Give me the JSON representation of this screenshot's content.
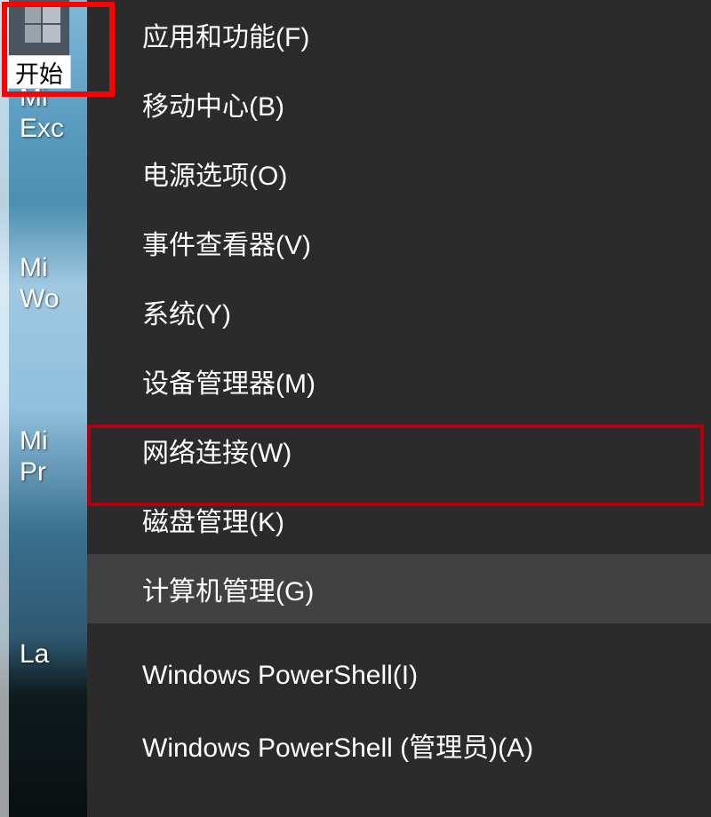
{
  "start": {
    "tooltip": "开始"
  },
  "desktop_icons": {
    "excel_lines": "Mi\nExc",
    "word_lines": "Mi\nWo",
    "ppt_lines": "Mi\nPr",
    "last_line": "La"
  },
  "menu": {
    "items": [
      {
        "label": "应用和功能(F)",
        "name": "apps-and-features"
      },
      {
        "label": "移动中心(B)",
        "name": "mobility-center"
      },
      {
        "label": "电源选项(O)",
        "name": "power-options"
      },
      {
        "label": "事件查看器(V)",
        "name": "event-viewer"
      },
      {
        "label": "系统(Y)",
        "name": "system"
      },
      {
        "label": "设备管理器(M)",
        "name": "device-manager"
      },
      {
        "label": "网络连接(W)",
        "name": "network-connections"
      },
      {
        "label": "磁盘管理(K)",
        "name": "disk-management"
      },
      {
        "label": "计算机管理(G)",
        "name": "computer-management"
      },
      {
        "label": "Windows PowerShell(I)",
        "name": "powershell"
      },
      {
        "label": "Windows PowerShell (管理员)(A)",
        "name": "powershell-admin"
      }
    ]
  }
}
